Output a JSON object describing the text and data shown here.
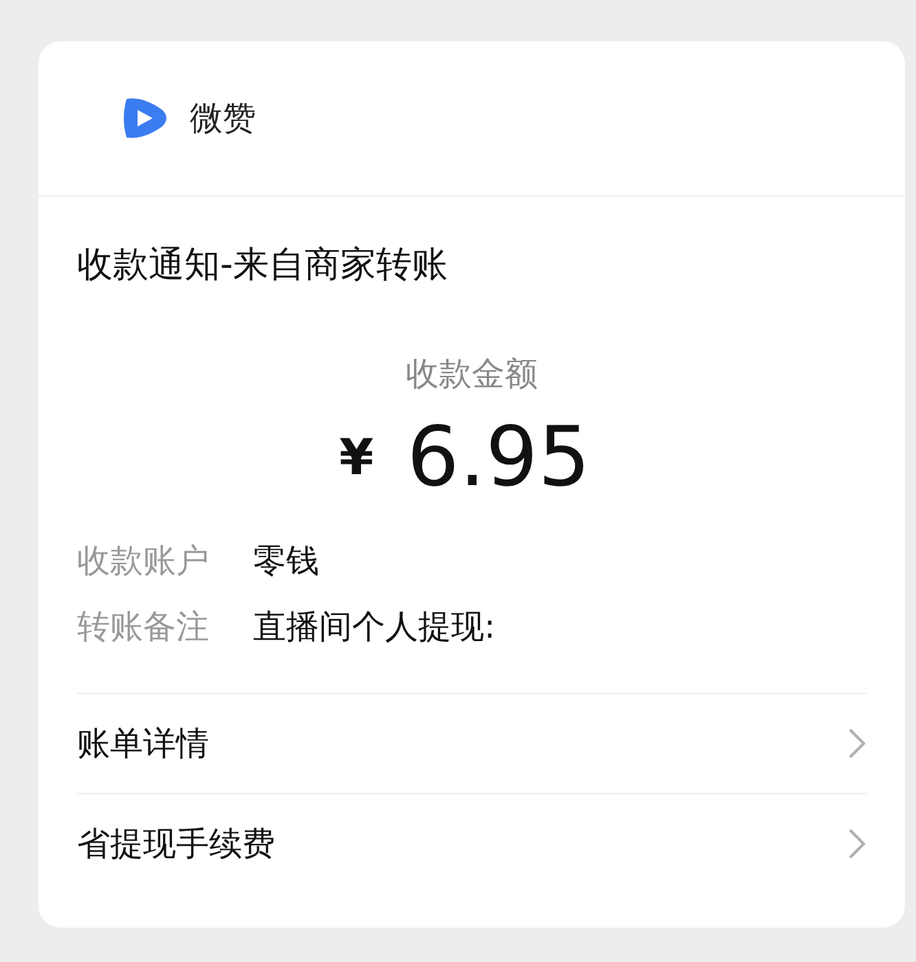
{
  "app": {
    "name": "微赞"
  },
  "notice": {
    "title": "收款通知-来自商家转账",
    "amount_label": "收款金额",
    "currency": "¥",
    "amount": "6.95",
    "fields": [
      {
        "label": "收款账户",
        "value": "零钱"
      },
      {
        "label": "转账备注",
        "value": "直播间个人提现:"
      }
    ]
  },
  "links": [
    {
      "label": "账单详情"
    },
    {
      "label": "省提现手续费"
    }
  ]
}
